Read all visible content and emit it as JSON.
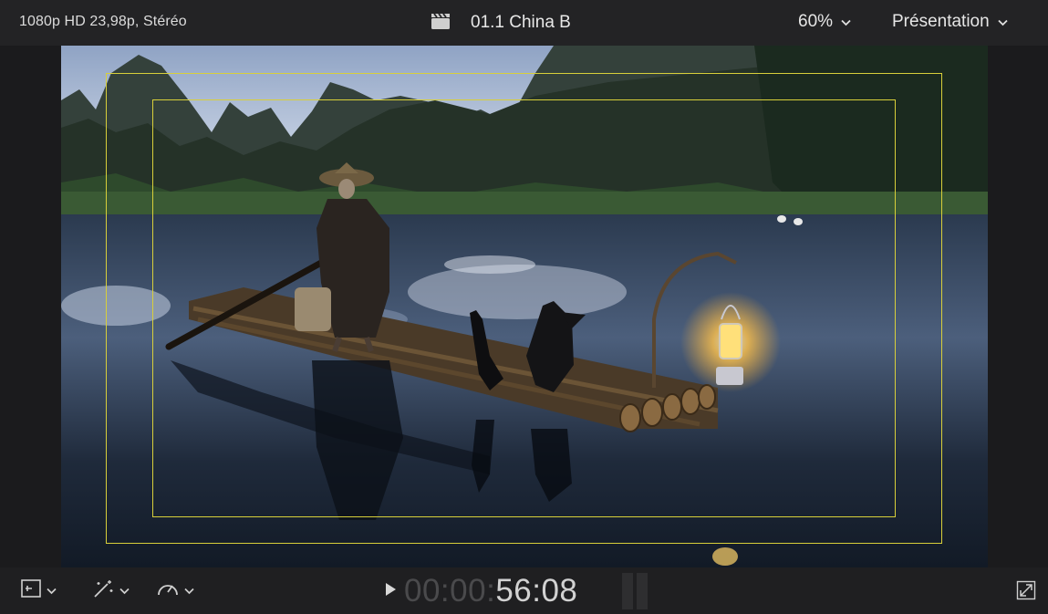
{
  "topbar": {
    "format_info": "1080p HD 23,98p, Stéréo",
    "clip_title": "01.1 China B",
    "zoom_label": "60%",
    "view_label": "Présentation"
  },
  "viewer": {
    "overlay_color": "#d8cf3a",
    "overlays": [
      "action-safe-zone",
      "title-safe-zone"
    ]
  },
  "bottombar": {
    "timecode_dim": "00:00:",
    "timecode_bright": "56:08",
    "tools": [
      "transform-tool-icon",
      "enhancement-wand-icon",
      "retime-speed-icon"
    ]
  },
  "colors": {
    "background": "#1b1b1d",
    "topbar": "#232325",
    "bottombar": "#1f1f21",
    "timecode_dim": "#4a4a4c",
    "timecode_bright": "#d2d2d2"
  }
}
